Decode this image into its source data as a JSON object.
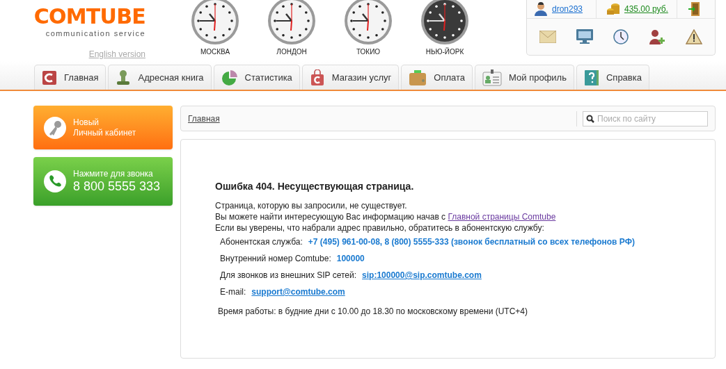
{
  "logo": {
    "name": "COMTUBE",
    "tagline": "communication service"
  },
  "language_link": "English version",
  "clocks": [
    {
      "city": "МОСКВА",
      "dark": false
    },
    {
      "city": "ЛОНДОН",
      "dark": false
    },
    {
      "city": "ТОКИО",
      "dark": false
    },
    {
      "city": "НЬЮ-ЙОРК",
      "dark": true
    }
  ],
  "account": {
    "user": "dron293",
    "balance": "435.00 руб."
  },
  "nav_tabs": [
    {
      "label": "Главная",
      "kind": "home"
    },
    {
      "label": "Адресная книга",
      "kind": "contacts"
    },
    {
      "label": "Статистика",
      "kind": "stats"
    },
    {
      "label": "Магазин услуг",
      "kind": "shop"
    },
    {
      "label": "Оплата",
      "kind": "wallet"
    },
    {
      "label": "Мой профиль",
      "kind": "profile"
    },
    {
      "label": "Справка",
      "kind": "help"
    }
  ],
  "sidebar": [
    {
      "kind": "cabinet",
      "line1": "Новый",
      "line2": "Личный кабинет"
    },
    {
      "kind": "call",
      "line1": "Нажмите для звонка",
      "line2": "8 800 5555 333"
    }
  ],
  "breadcrumb": "Главная",
  "search": {
    "placeholder": "Поиск по сайту"
  },
  "error": {
    "title": "Ошибка 404. Несуществующая страница.",
    "line1": "Страница, которую вы запросили, не существует.",
    "line2": "Вы можете найти интересующую Вас информацию начав с",
    "line2_link": "Главной страницы Comtube",
    "line3": "Если вы уверены, что набрали адрес правильно, обратитесь в абонентскую службу:",
    "contacts": [
      {
        "label": "Абонентская служба:",
        "value": "+7 (495) 961-00-08, 8 (800) 5555-333 (звонок бесплатный со всех телефонов РФ)",
        "link": false
      },
      {
        "label": "Внутренний номер Comtube:",
        "value": "100000",
        "link": false
      },
      {
        "label": "Для звонков из внешних SIP сетей:",
        "value": "sip:100000@sip.comtube.com",
        "link": true
      },
      {
        "label": "E-mail:",
        "value": "support@comtube.com",
        "link": true
      }
    ],
    "hours": "Время работы: в будние дни с 10.00 до 18.30 по московскому времени (UTC+4)"
  }
}
